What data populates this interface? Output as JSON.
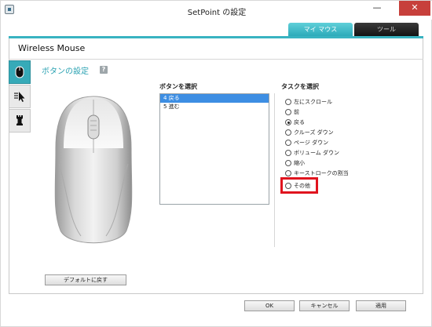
{
  "window": {
    "title": "SetPoint の設定",
    "minimize_glyph": "—",
    "close_glyph": "✕"
  },
  "top_tabs": [
    {
      "label": "マイ マウス",
      "active": true
    },
    {
      "label": "ツール",
      "active": false
    }
  ],
  "device": {
    "name": "Wireless Mouse"
  },
  "section": {
    "title": "ボタンの設定",
    "help_glyph": "?"
  },
  "button_select": {
    "label": "ボタンを選択",
    "items": [
      {
        "label": "4  戻る",
        "selected": true
      },
      {
        "label": "5  進む",
        "selected": false
      }
    ]
  },
  "task_select": {
    "label": "タスクを選択",
    "options": [
      {
        "label": "左にスクロール",
        "checked": false
      },
      {
        "label": "前",
        "checked": false
      },
      {
        "label": "戻る",
        "checked": true
      },
      {
        "label": "クルーズ ダウン",
        "checked": false
      },
      {
        "label": "ページ ダウン",
        "checked": false
      },
      {
        "label": "ボリューム ダウン",
        "checked": false
      },
      {
        "label": "縮小",
        "checked": false
      },
      {
        "label": "キーストロークの割当",
        "checked": false
      },
      {
        "label": "その他",
        "checked": false
      }
    ]
  },
  "buttons": {
    "default": "デフォルトに戻す",
    "ok": "OK",
    "cancel": "キャンセル",
    "apply": "適用"
  },
  "colors": {
    "accent_teal": "#36aab8",
    "selection_blue": "#3d8ee3",
    "highlight_red": "#e0141e",
    "close_red": "#c7403b"
  },
  "icons": {
    "vtab_1": "mouse-icon",
    "vtab_2": "pointer-speed-icon",
    "vtab_3": "game-piece-icon"
  }
}
